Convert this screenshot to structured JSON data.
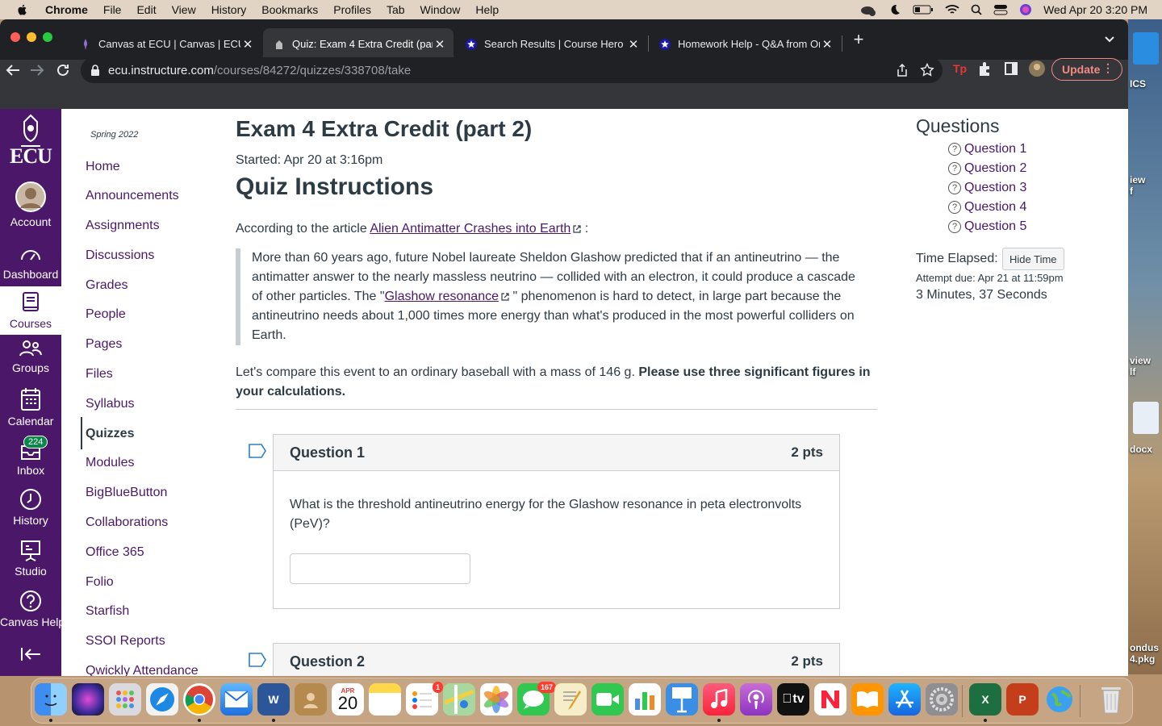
{
  "menubar": {
    "app": "Chrome",
    "items": [
      "File",
      "Edit",
      "View",
      "History",
      "Bookmarks",
      "Profiles",
      "Tab",
      "Window",
      "Help"
    ],
    "datetime": "Wed Apr 20  3:20 PM"
  },
  "desktop": {
    "labels": [
      "ICS",
      "iew\nf",
      "view\nlf",
      "docx",
      "ondus\n4.pkg"
    ]
  },
  "tabs": [
    {
      "title": "Canvas at ECU | Canvas | ECU",
      "active": false
    },
    {
      "title": "Quiz: Exam 4 Extra Credit (part",
      "active": true
    },
    {
      "title": "Search Results | Course Hero",
      "active": false
    },
    {
      "title": "Homework Help - Q&A from Or",
      "active": false
    }
  ],
  "omnibox": {
    "host": "ecu.instructure.com",
    "path": "/courses/84272/quizzes/338708/take"
  },
  "update_label": "Update",
  "global_nav": {
    "logo_text": "ECU",
    "items": [
      {
        "label": "Account"
      },
      {
        "label": "Dashboard"
      },
      {
        "label": "Courses"
      },
      {
        "label": "Groups"
      },
      {
        "label": "Calendar"
      },
      {
        "label": "Inbox"
      },
      {
        "label": "History"
      },
      {
        "label": "Studio"
      },
      {
        "label": "Canvas Help"
      }
    ],
    "inbox_badge": "224"
  },
  "course_nav": {
    "term": "Spring 2022",
    "items": [
      "Home",
      "Announcements",
      "Assignments",
      "Discussions",
      "Grades",
      "People",
      "Pages",
      "Files",
      "Syllabus",
      "Quizzes",
      "Modules",
      "BigBlueButton",
      "Collaborations",
      "Office 365",
      "Folio",
      "Starfish",
      "SSOI Reports",
      "Qwickly Attendance"
    ],
    "active": "Quizzes"
  },
  "quiz": {
    "title": "Exam 4 Extra Credit (part 2)",
    "started": "Started: Apr 20 at 3:16pm",
    "instructions_title": "Quiz Instructions",
    "according_prefix": "According to the article ",
    "article_link": "Alien Antimatter Crashes into Earth",
    "according_suffix": " :",
    "quote_part1": "More than 60 years ago, future Nobel laureate Sheldon Glashow predicted that if an antineutrino — the antimatter answer to the nearly massless neutrino — collided with an electron, it could produce a cascade of other particles. The \"",
    "quote_link": "Glashow resonance",
    "quote_part2": " \" phenomenon is hard to detect, in large part because the antineutrino needs about 1,000 times more energy than what's produced in the most powerful colliders on Earth.",
    "compare_plain": "Let's compare this event to an ordinary baseball with a mass of 146 g. ",
    "compare_bold": "Please use three significant figures in your calculations.",
    "questions": [
      {
        "title": "Question 1",
        "points": "2 pts",
        "text": "What is the threshold antineutrino energy for the Glashow resonance in peta electronvolts (PeV)?"
      },
      {
        "title": "Question 2",
        "points": "2 pts"
      }
    ]
  },
  "sidebar": {
    "heading": "Questions",
    "links": [
      "Question 1",
      "Question 2",
      "Question 3",
      "Question 4",
      "Question 5"
    ],
    "time_elapsed_label": "Time Elapsed:",
    "hide_time_label": "Hide Time",
    "attempt_due": "Attempt due: Apr 21 at 11:59pm",
    "elapsed": "3 Minutes, 37 Seconds"
  },
  "dock": {
    "calendar_month": "APR",
    "calendar_day": "20",
    "reminders_badge": "1",
    "messages_badge": "167",
    "tv_label": "tv"
  },
  "colors": {
    "canvas_purple": "#4b1869",
    "text": "#2d3b45",
    "chrome_dark": "#202124",
    "update_red": "#f28b82"
  }
}
